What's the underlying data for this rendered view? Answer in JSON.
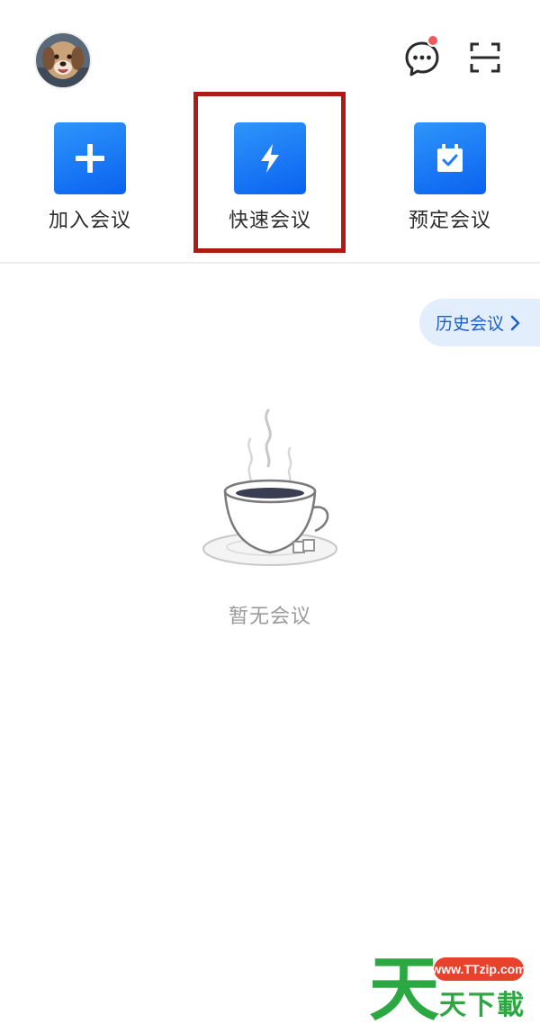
{
  "header": {
    "avatar": "user-avatar-dog-photo",
    "message_icon": "chat-bubble-icon",
    "scan_icon": "scan-icon"
  },
  "actions": [
    {
      "label": "加入会议",
      "icon": "plus-icon"
    },
    {
      "label": "快速会议",
      "icon": "lightning-icon"
    },
    {
      "label": "预定会议",
      "icon": "calendar-check-icon"
    }
  ],
  "history": {
    "label": "历史会议",
    "icon": "chevron-right-icon"
  },
  "empty_state": {
    "text": "暂无会议",
    "illustration": "coffee-cup-illustration"
  },
  "watermark": {
    "big": "天",
    "url": "www.TTzip.com",
    "sub": "天下載"
  },
  "colors": {
    "accent": "#1a73f5",
    "highlight_border": "#b01a14",
    "notification_dot": "#f05a5a",
    "history_bg": "#e3eefc",
    "history_text": "#1d5fc7",
    "watermark_green": "#2ca843",
    "watermark_red": "#e8412c"
  }
}
